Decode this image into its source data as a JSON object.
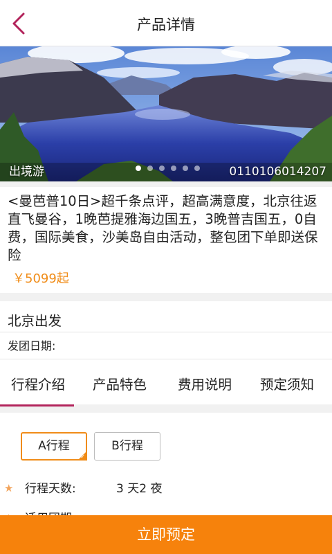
{
  "header": {
    "title": "产品详情",
    "back_icon": "chevron-left-icon",
    "accent_color": "#b2235b"
  },
  "hero": {
    "category_label": "出境游",
    "product_code": "0110106014207",
    "slide_count": 6,
    "active_slide": 1
  },
  "product": {
    "title": "<曼芭普10日>超千条点评，超高满意度，北京往返直飞曼谷，1晚芭提雅海边国五，3晚普吉国五，0自费，国际美食，沙美岛自由活动，整包团下单即送保险",
    "price": "￥5099起",
    "price_color": "#f08c18"
  },
  "departure": {
    "city": "北京出发",
    "date_label": "发团日期:"
  },
  "tabs": [
    {
      "label": "行程介绍",
      "active": true
    },
    {
      "label": "产品特色",
      "active": false
    },
    {
      "label": "费用说明",
      "active": false
    },
    {
      "label": "预定须知",
      "active": false
    }
  ],
  "routes": {
    "a_label": "A行程",
    "b_label": "B行程",
    "selected": "A"
  },
  "details": [
    {
      "label": "行程天数:",
      "value": "3 天2 夜"
    },
    {
      "label": "适用团期",
      "value": ""
    }
  ],
  "footer": {
    "book_label": "立即预定",
    "button_color": "#f6820c"
  }
}
